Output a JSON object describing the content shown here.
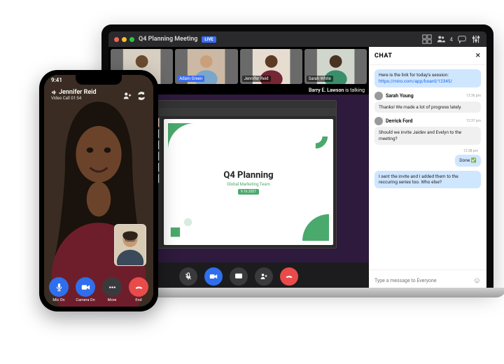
{
  "laptop": {
    "title": "Q4 Planning Meeting",
    "live_badge": "LIVE",
    "participant_count": "4",
    "talking_name": "Barry E. Lawson",
    "talking_suffix": " is talking",
    "participants": [
      {
        "label": ""
      },
      {
        "label": "Adam Green"
      },
      {
        "label": "Jennifer Reid"
      },
      {
        "label": "Sarah White"
      }
    ],
    "slide": {
      "title": "Q4 Planning",
      "subtitle": "Global Marketing Team",
      "date": "9.16.2021"
    },
    "chat": {
      "heading": "CHAT",
      "messages": [
        {
          "type": "self",
          "text": "Here is the link for today's session: ",
          "link": "https://miro.com/app/board/12345/"
        },
        {
          "type": "other",
          "name": "Sarah Young",
          "time": "12:36 pm",
          "text": "Thanks! We made a lot of progress lately."
        },
        {
          "type": "other",
          "name": "Derrick Ford",
          "time": "12:37 pm",
          "text": "Should we invite Jaidev and Evelyn to the meeting?"
        },
        {
          "type": "self",
          "time": "12:38 pm",
          "text": "Done ✅"
        },
        {
          "type": "self",
          "text": "I sent the invite and I added them to the reccuring series too. Who else?"
        }
      ],
      "placeholder": "Type a message to Everyone"
    }
  },
  "phone": {
    "time": "9:41",
    "name": "Jennifer Reid",
    "sub_prefix": "Video Call",
    "duration": "01:54",
    "controls": {
      "mic": "Mic On",
      "camera": "Camera On",
      "more": "More",
      "end": "End"
    }
  }
}
